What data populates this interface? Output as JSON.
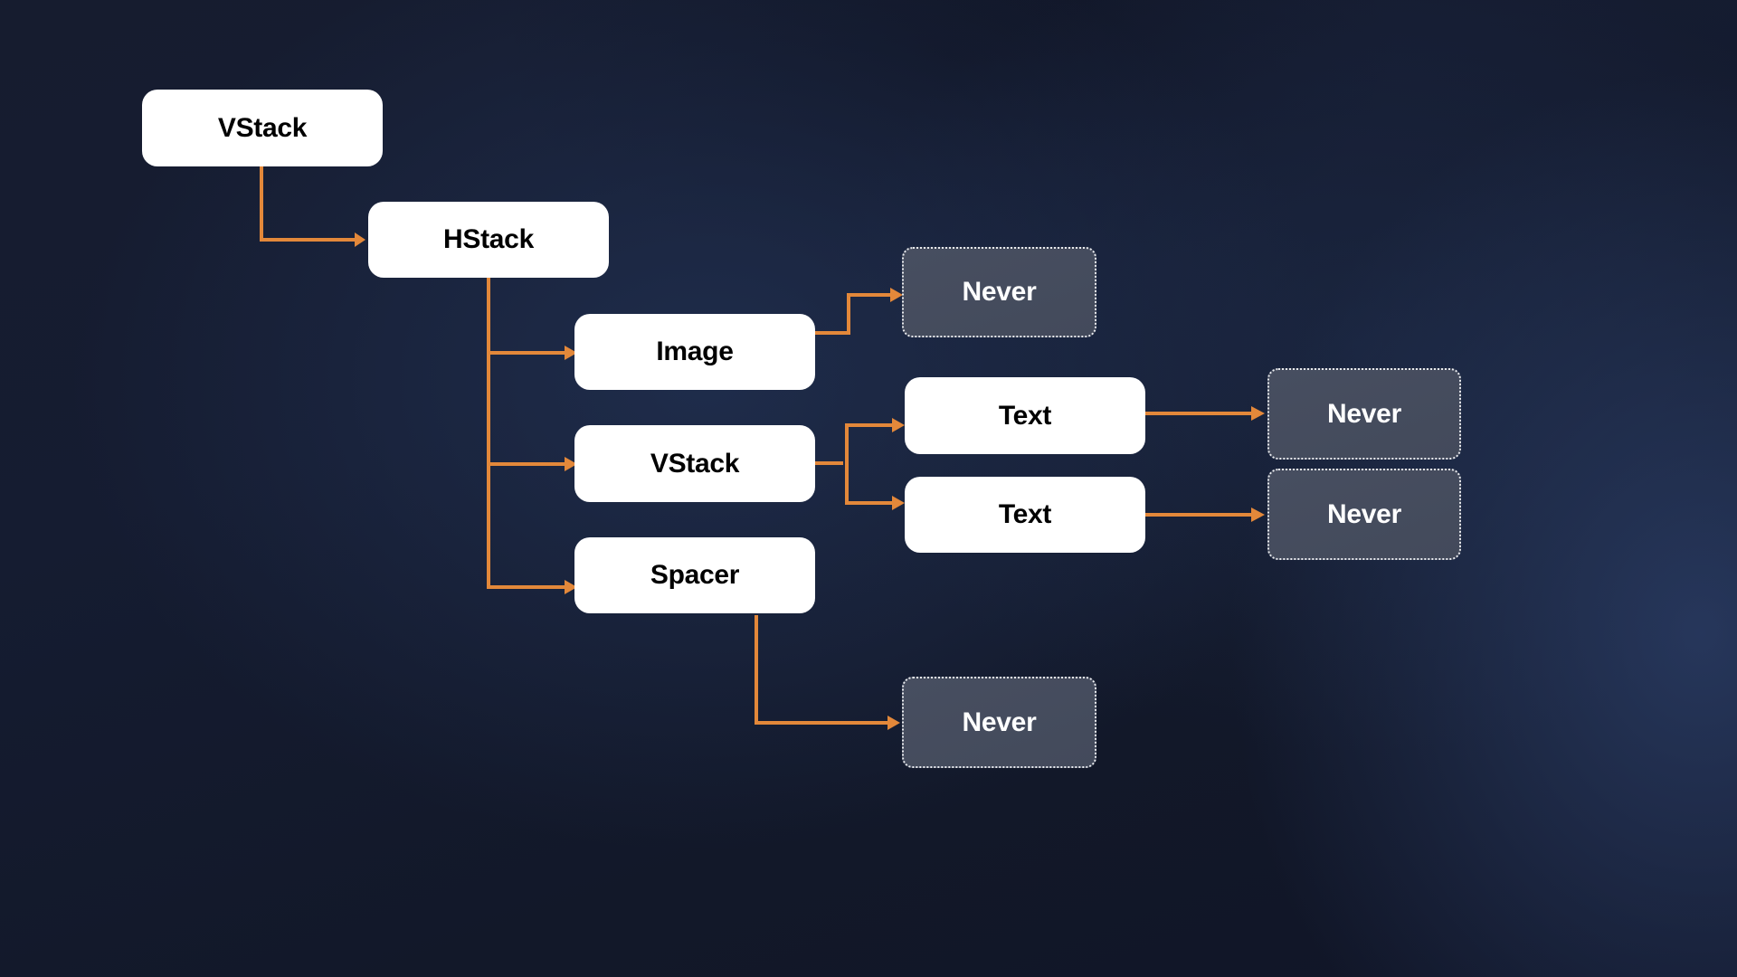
{
  "diagram": {
    "title": "",
    "accent_color": "#e3883a",
    "nodes": [
      {
        "id": "vstack-root",
        "label": "VStack",
        "kind": "view"
      },
      {
        "id": "hstack",
        "label": "HStack",
        "kind": "view"
      },
      {
        "id": "image",
        "label": "Image",
        "kind": "view"
      },
      {
        "id": "vstack-inner",
        "label": "VStack",
        "kind": "view"
      },
      {
        "id": "spacer",
        "label": "Spacer",
        "kind": "view"
      },
      {
        "id": "text-1",
        "label": "Text",
        "kind": "view"
      },
      {
        "id": "text-2",
        "label": "Text",
        "kind": "view"
      },
      {
        "id": "never-image",
        "label": "Never",
        "kind": "never"
      },
      {
        "id": "never-text-1",
        "label": "Never",
        "kind": "never"
      },
      {
        "id": "never-text-2",
        "label": "Never",
        "kind": "never"
      },
      {
        "id": "never-spacer",
        "label": "Never",
        "kind": "never"
      }
    ],
    "edges": [
      {
        "from": "vstack-root",
        "to": "hstack"
      },
      {
        "from": "hstack",
        "to": "image"
      },
      {
        "from": "hstack",
        "to": "vstack-inner"
      },
      {
        "from": "hstack",
        "to": "spacer"
      },
      {
        "from": "image",
        "to": "never-image"
      },
      {
        "from": "vstack-inner",
        "to": "text-1"
      },
      {
        "from": "vstack-inner",
        "to": "text-2"
      },
      {
        "from": "text-1",
        "to": "never-text-1"
      },
      {
        "from": "text-2",
        "to": "never-text-2"
      },
      {
        "from": "spacer",
        "to": "never-spacer"
      }
    ]
  }
}
